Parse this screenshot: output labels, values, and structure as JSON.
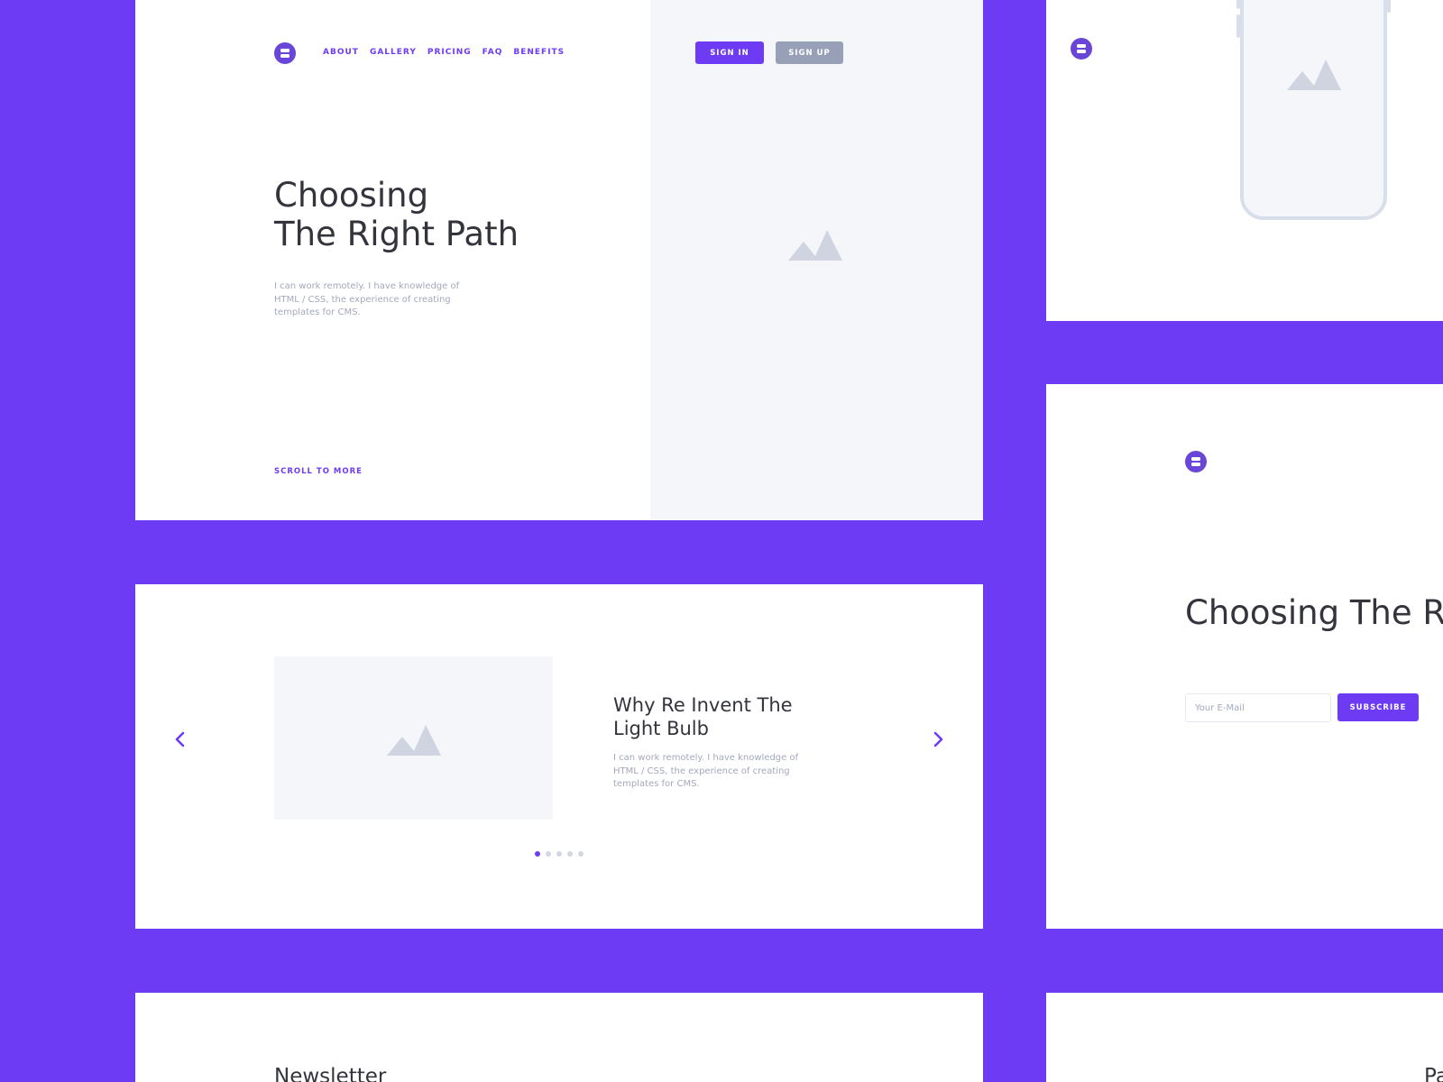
{
  "hero": {
    "nav": [
      "ABOUT",
      "GALLERY",
      "PRICING",
      "FAQ",
      "BENEFITS"
    ],
    "sign_in": "SIGN IN",
    "sign_up": "SIGN UP",
    "title": "Choosing\nThe Right Path",
    "text": "I can work remotely. I have knowledge of HTML / CSS, the experience of creating templates for CMS.",
    "scroll_label": "SCROLL TO MORE"
  },
  "carousel": {
    "title": "Why Re Invent The\nLight Bulb",
    "text": "I can work remotely. I have knowledge of HTML / CSS, the experience of creating templates for CMS.",
    "dots": 5,
    "active_dot": 1
  },
  "newsletter": {
    "title": "Newsletter"
  },
  "subscribe": {
    "title": "Choosing\nThe Right Path",
    "email_placeholder": "Your E-Mail",
    "button": "SUBSCRIBE"
  },
  "peek": {
    "title": "Pa"
  },
  "colors": {
    "brand": "#6e3bf5",
    "logo": "#6a46d8",
    "heading": "#33343c",
    "muted_text": "#a4a8bc",
    "placeholder_bg": "#f5f6fa",
    "placeholder_icon": "#cfd4e0",
    "secondary_button": "#98a0b8"
  },
  "icons": {
    "logo": "logo-icon",
    "image_placeholder": "mountain-image-icon",
    "prev": "chevron-left-icon",
    "next": "chevron-right-icon"
  }
}
